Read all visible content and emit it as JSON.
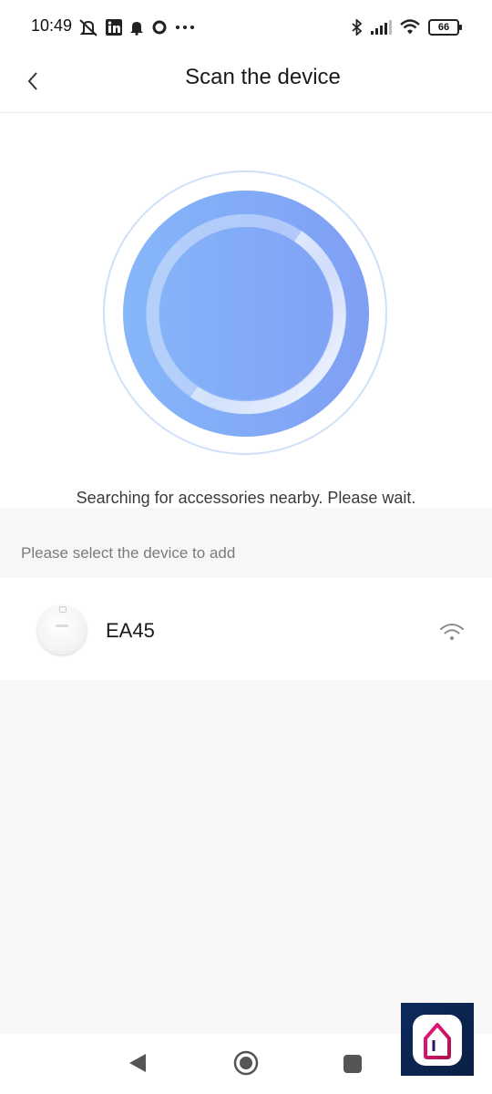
{
  "status_bar": {
    "time": "10:49",
    "battery": "66",
    "icons_left": [
      "mute-icon",
      "linkedin-icon",
      "bell-icon",
      "ring-icon",
      "more-dots-icon"
    ],
    "icons_right": [
      "bluetooth-icon",
      "signal-icon",
      "wifi-icon",
      "battery-icon"
    ]
  },
  "header": {
    "title": "Scan the device",
    "back_icon": "chevron-left-icon"
  },
  "scan": {
    "message": "Searching for accessories nearby. Please wait.",
    "colors": {
      "disc_start": "#86b6f9",
      "disc_end": "#7f9ff4",
      "ring": "#cfe0f7"
    }
  },
  "device_list": {
    "label": "Please select the device to add",
    "devices": [
      {
        "name": "EA45",
        "icon": "robot-vacuum-thumbnail",
        "signal_icon": "wifi-signal-icon"
      }
    ]
  },
  "nav": {
    "buttons": [
      "back-triangle-icon",
      "home-circle-icon",
      "recent-square-icon"
    ]
  }
}
